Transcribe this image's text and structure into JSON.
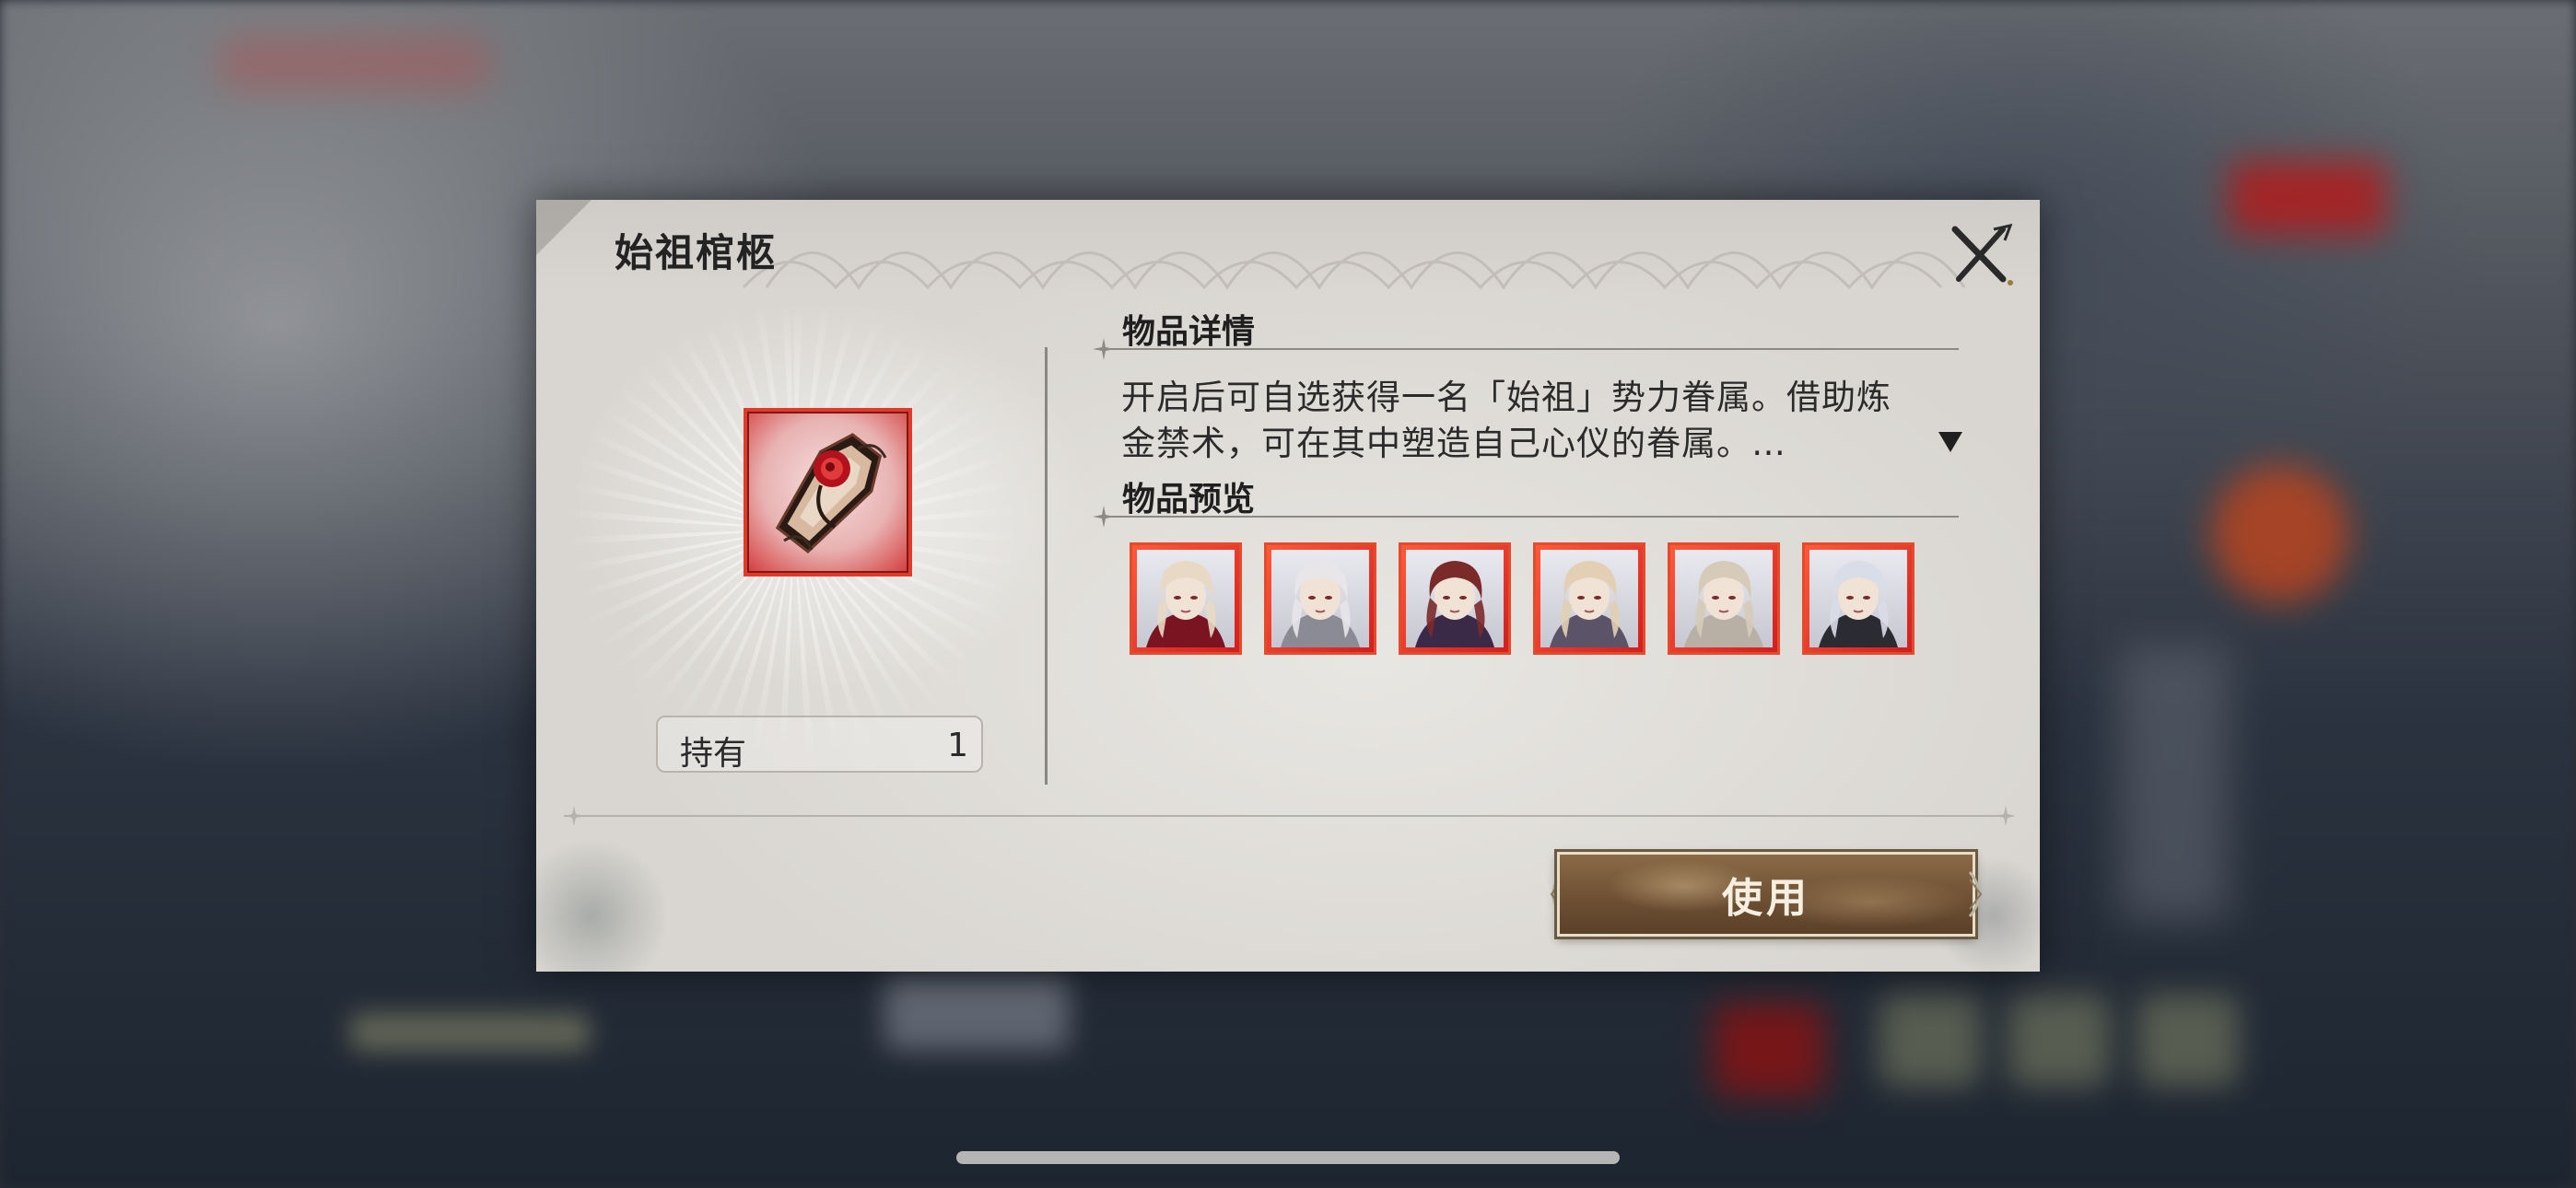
{
  "dialog": {
    "title": "始祖棺柩",
    "close_icon": "close-x-icon"
  },
  "item": {
    "icon": "coffin-rose-icon",
    "holding_label": "持有",
    "holding_count": "1"
  },
  "details": {
    "heading": "物品详情",
    "description_line1": "开启后可自选获得一名「始祖」势力眷属。借助炼",
    "description_line2": "金禁术，可在其中塑造自己心仪的眷属。…",
    "expand_icon": "triangle-down-icon"
  },
  "preview": {
    "heading": "物品预览",
    "portraits": [
      {
        "name": "blonde-vampire-woman",
        "hair": "#e8d9c4",
        "outfit": "#7a1420"
      },
      {
        "name": "silver-haired-woman",
        "hair": "#e9e6ea",
        "outfit": "#8b8b95"
      },
      {
        "name": "red-haired-man",
        "hair": "#7b2a2a",
        "outfit": "#3a2a48"
      },
      {
        "name": "blonde-man",
        "hair": "#e2cfb4",
        "outfit": "#5b5368"
      },
      {
        "name": "light-haired-woman",
        "hair": "#d6cbb8",
        "outfit": "#b8b0a5"
      },
      {
        "name": "white-haired-man",
        "hair": "#d9dde8",
        "outfit": "#2b2b33"
      }
    ]
  },
  "actions": {
    "use_label": "使用"
  },
  "colors": {
    "accent_red": "#e23a2a",
    "button_brown": "#6e5033"
  }
}
